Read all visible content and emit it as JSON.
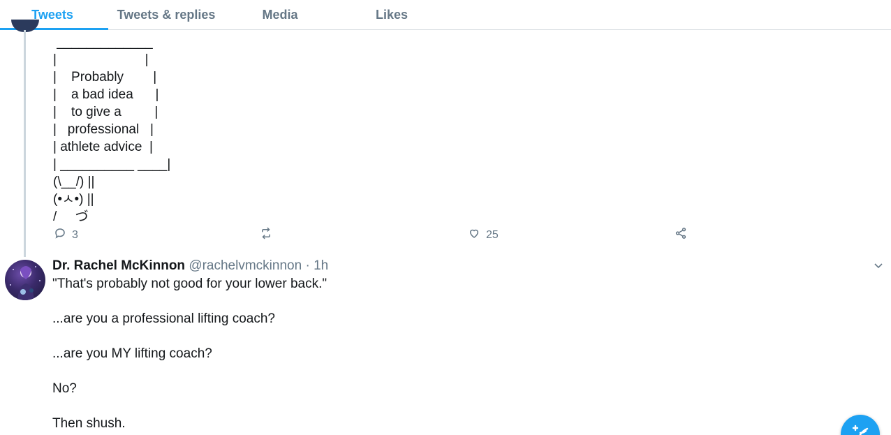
{
  "tabs": [
    {
      "label": "Tweets",
      "active": true
    },
    {
      "label": "Tweets & replies",
      "active": false
    },
    {
      "label": "Media",
      "active": false
    },
    {
      "label": "Likes",
      "active": false
    }
  ],
  "tweet1": {
    "ascii_lines": [
      " _____________",
      "|                        |",
      "|    Probably        |",
      "|    a bad idea      |",
      "|    to give a         |",
      "|   professional   |",
      "| athlete advice  |",
      "| __________ ____|",
      "(\\__/) ||",
      "(•ㅅ•) ||",
      "/     づ"
    ],
    "actions": {
      "reply_count": "3",
      "retweet_count": "",
      "like_count": "25"
    }
  },
  "tweet2": {
    "name": "Dr. Rachel McKinnon",
    "handle": "@rachelvmckinnon",
    "separator": "·",
    "time": "1h",
    "paragraphs": [
      "\"That's probably not good for your lower back.\"",
      "...are you a professional lifting coach?",
      "...are you MY lifting coach?",
      "No?",
      "Then shush."
    ]
  },
  "colors": {
    "accent": "#1da1f2",
    "secondary_text": "#657786",
    "primary_text": "#14171a",
    "divider": "#d8dde1"
  },
  "icons": [
    "reply-icon",
    "retweet-icon",
    "like-icon",
    "share-icon",
    "chevron-down-icon",
    "compose-icon"
  ]
}
